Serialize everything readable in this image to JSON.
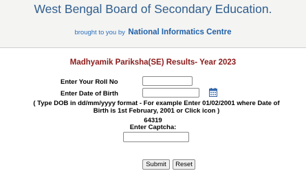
{
  "header": {
    "board_title": "West Bengal Board of Secondary Education.",
    "by_prefix": "brought to you by",
    "by_org": "National Informatics Centre"
  },
  "form": {
    "results_title": "Madhyamik Pariksha(SE) Results- Year 2023",
    "roll_label": "Enter Your Roll No",
    "roll_value": "",
    "dob_label": "Enter Date of Birth",
    "dob_value": "",
    "calendar_icon": "calendar-icon",
    "dob_note": "( Type DOB in dd/mm/yyyy format - For example Enter 01/02/2001 where Date of Birth is 1st February, 2001 or Click icon   )",
    "captcha_code": "64319",
    "captcha_label": "Enter Captcha:",
    "captcha_value": "",
    "submit_label": "Submit",
    "reset_label": "Reset"
  },
  "colors": {
    "header_bg": "#f4f4f2",
    "title_blue": "#2f5d8e",
    "results_red": "#8b1a1a"
  }
}
